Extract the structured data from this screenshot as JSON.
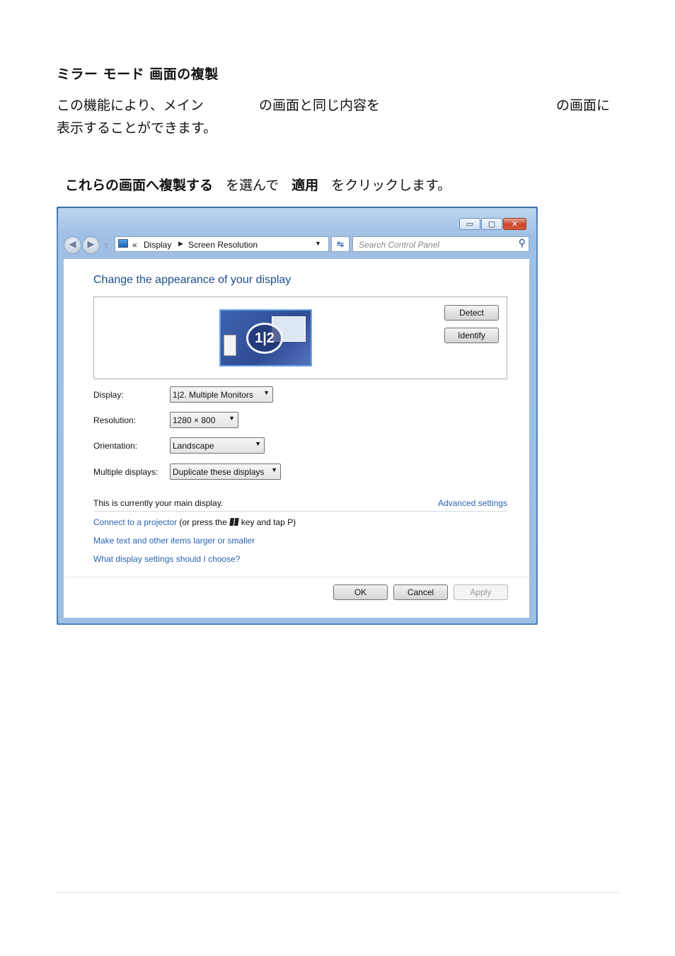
{
  "doc": {
    "heading": "ミラー モード 画面の複製",
    "para_seg1": "この機能により、メイン",
    "para_seg2": "の画面と同じ内容を",
    "para_seg3": "の画面に",
    "para_line2": "表示することができます。",
    "instr_bold1": "これらの画面へ複製する",
    "instr_text1": "を選んで",
    "instr_bold2": "適用",
    "instr_text2": "をクリックします。"
  },
  "window": {
    "caption_buttons": {
      "minimize": "▭",
      "maximize": "▢",
      "close": "✕"
    },
    "address": {
      "chevrons": "«",
      "crumb1": "Display",
      "crumb2": "Screen Resolution"
    },
    "search_placeholder": "Search Control Panel",
    "title": "Change the appearance of your display",
    "preview": {
      "badge": "1|2",
      "detect_label": "Detect",
      "identify_label": "Identify"
    },
    "fields": {
      "display_label": "Display:",
      "display_value": "1|2. Multiple Monitors",
      "resolution_label": "Resolution:",
      "resolution_value": "1280 × 800",
      "orientation_label": "Orientation:",
      "orientation_value": "Landscape",
      "multiple_label": "Multiple displays:",
      "multiple_value": "Duplicate these displays"
    },
    "main_display_text": "This is currently your main display.",
    "advanced_link": "Advanced settings",
    "links": {
      "projector_link": "Connect to a projector",
      "projector_rest1": "(or press the",
      "projector_rest2": "key and tap P)",
      "text_size_link": "Make text and other items larger or smaller",
      "which_settings_link": "What display settings should I choose?"
    },
    "buttons": {
      "ok": "OK",
      "cancel": "Cancel",
      "apply": "Apply"
    }
  },
  "colors": {
    "link": "#2a64b0",
    "title": "#1e4d8c",
    "frame": "#4d80bd"
  }
}
